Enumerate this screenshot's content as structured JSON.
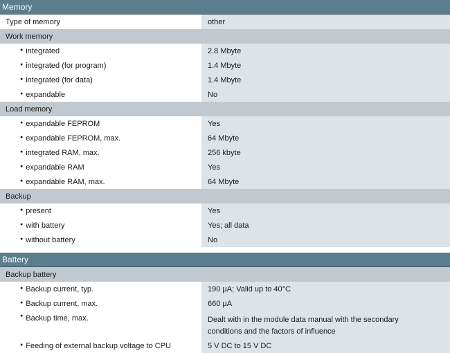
{
  "memory": {
    "header": "Memory",
    "type_label": "Type of memory",
    "type_value": "other",
    "work": {
      "title": "Work memory",
      "rows": [
        {
          "label": "integrated",
          "value": "2.8 Mbyte"
        },
        {
          "label": "integrated (for program)",
          "value": "1.4 Mbyte"
        },
        {
          "label": "integrated (for data)",
          "value": "1.4 Mbyte"
        },
        {
          "label": "expandable",
          "value": "No"
        }
      ]
    },
    "load": {
      "title": "Load memory",
      "rows": [
        {
          "label": "expandable FEPROM",
          "value": "Yes"
        },
        {
          "label": "expandable FEPROM, max.",
          "value": "64 Mbyte"
        },
        {
          "label": "integrated RAM, max.",
          "value": "256 kbyte"
        },
        {
          "label": "expandable RAM",
          "value": "Yes"
        },
        {
          "label": "expandable RAM, max.",
          "value": "64 Mbyte"
        }
      ]
    },
    "backup": {
      "title": "Backup",
      "rows": [
        {
          "label": "present",
          "value": "Yes"
        },
        {
          "label": "with battery",
          "value": "Yes; all data"
        },
        {
          "label": "without battery",
          "value": "No"
        }
      ]
    }
  },
  "battery": {
    "header": "Battery",
    "backup_battery": {
      "title": "Backup battery",
      "rows": [
        {
          "label": "Backup current, typ.",
          "value": "190 µA; Valid up to 40°C"
        },
        {
          "label": "Backup current, max.",
          "value": "660 µA"
        },
        {
          "label": "Backup time, max.",
          "value": "Dealt with in the module data manual with the secondary conditions and the factors of influence"
        },
        {
          "label": "Feeding of external backup voltage to CPU",
          "value": "5 V DC to 15 V DC"
        }
      ]
    }
  }
}
